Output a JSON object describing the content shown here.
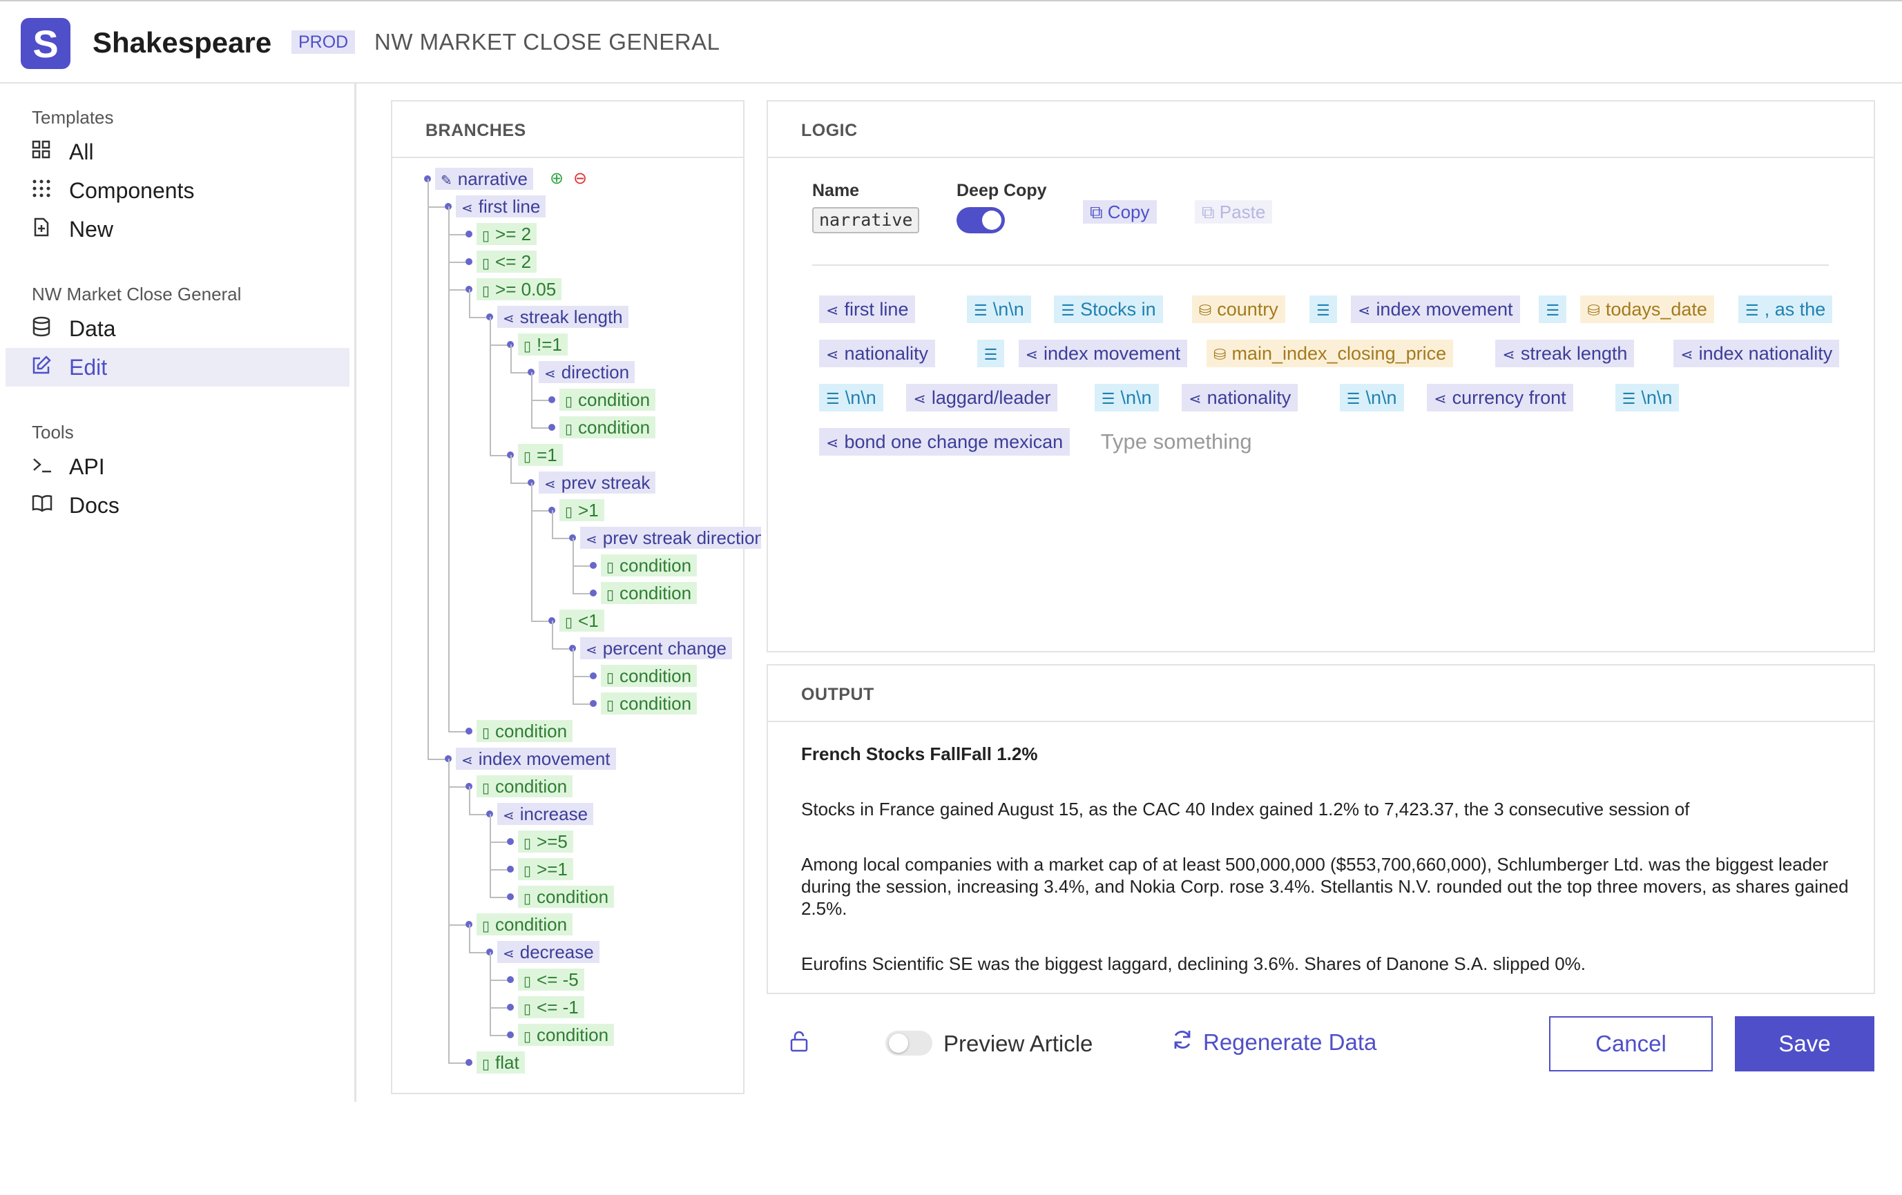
{
  "app": {
    "logo_letter": "S",
    "name": "Shakespeare",
    "env_badge": "PROD",
    "page_title": "NW MARKET CLOSE GENERAL"
  },
  "sidebar": {
    "sections": [
      {
        "title": "Templates",
        "items": [
          {
            "label": "All",
            "icon": "grid-icon"
          },
          {
            "label": "Components",
            "icon": "dots-grid-icon"
          },
          {
            "label": "New",
            "icon": "new-file-icon"
          }
        ]
      },
      {
        "title": "NW Market Close General",
        "items": [
          {
            "label": "Data",
            "icon": "database-icon"
          },
          {
            "label": "Edit",
            "icon": "edit-icon",
            "active": true
          }
        ]
      },
      {
        "title": "Tools",
        "items": [
          {
            "label": "API",
            "icon": "terminal-icon"
          },
          {
            "label": "Docs",
            "icon": "book-icon"
          }
        ]
      }
    ]
  },
  "branches": {
    "title": "BRANCHES",
    "nodes": [
      {
        "label": "narrative",
        "kind": "root",
        "depth": 0
      },
      {
        "label": "first line",
        "kind": "branch",
        "depth": 1
      },
      {
        "label": ">= 2",
        "kind": "condition",
        "depth": 2
      },
      {
        "label": "<= 2",
        "kind": "condition",
        "depth": 2
      },
      {
        "label": ">= 0.05",
        "kind": "condition",
        "depth": 2
      },
      {
        "label": "streak length",
        "kind": "branch",
        "depth": 3
      },
      {
        "label": "!=1",
        "kind": "condition",
        "depth": 4
      },
      {
        "label": "direction",
        "kind": "branch",
        "depth": 5
      },
      {
        "label": "condition",
        "kind": "condition",
        "depth": 6
      },
      {
        "label": "condition",
        "kind": "condition",
        "depth": 6
      },
      {
        "label": "=1",
        "kind": "condition",
        "depth": 4
      },
      {
        "label": "prev streak",
        "kind": "branch",
        "depth": 5
      },
      {
        "label": ">1",
        "kind": "condition",
        "depth": 6
      },
      {
        "label": "prev streak direction",
        "kind": "branch",
        "depth": 7
      },
      {
        "label": "condition",
        "kind": "condition",
        "depth": 8
      },
      {
        "label": "condition",
        "kind": "condition",
        "depth": 8
      },
      {
        "label": "<1",
        "kind": "condition",
        "depth": 6
      },
      {
        "label": "percent change",
        "kind": "branch",
        "depth": 7
      },
      {
        "label": "condition",
        "kind": "condition",
        "depth": 8
      },
      {
        "label": "condition",
        "kind": "condition",
        "depth": 8
      },
      {
        "label": "condition",
        "kind": "condition",
        "depth": 2
      },
      {
        "label": "index movement",
        "kind": "branch",
        "depth": 1
      },
      {
        "label": "condition",
        "kind": "condition",
        "depth": 2
      },
      {
        "label": "increase",
        "kind": "branch",
        "depth": 3
      },
      {
        "label": ">=5",
        "kind": "condition",
        "depth": 4
      },
      {
        "label": ">=1",
        "kind": "condition",
        "depth": 4
      },
      {
        "label": "condition",
        "kind": "condition",
        "depth": 4
      },
      {
        "label": "condition",
        "kind": "condition",
        "depth": 2
      },
      {
        "label": "decrease",
        "kind": "branch",
        "depth": 3
      },
      {
        "label": "<= -5",
        "kind": "condition",
        "depth": 4
      },
      {
        "label": "<= -1",
        "kind": "condition",
        "depth": 4
      },
      {
        "label": "condition",
        "kind": "condition",
        "depth": 4
      },
      {
        "label": "flat",
        "kind": "condition",
        "depth": 2
      }
    ]
  },
  "logic": {
    "title": "LOGIC",
    "name_label": "Name",
    "name_value": "narrative",
    "deep_copy_label": "Deep Copy",
    "deep_copy_on": true,
    "copy_label": "Copy",
    "paste_label": "Paste",
    "input_placeholder": "Type something",
    "tokens": [
      [
        {
          "text": "first line",
          "type": "branch"
        },
        {
          "text": "\\n\\n",
          "type": "text"
        },
        {
          "text": "Stocks in",
          "type": "text"
        },
        {
          "text": "country",
          "type": "data"
        },
        {
          "text": "",
          "type": "text"
        },
        {
          "text": "index movement",
          "type": "branch"
        },
        {
          "text": "",
          "type": "text"
        },
        {
          "text": "todays_date",
          "type": "data"
        },
        {
          "text": ", as the",
          "type": "text"
        }
      ],
      [
        {
          "text": "nationality",
          "type": "branch"
        },
        {
          "text": "",
          "type": "text"
        },
        {
          "text": "index movement",
          "type": "branch"
        },
        {
          "text": "main_index_closing_price",
          "type": "data"
        },
        {
          "text": "streak length",
          "type": "branch"
        },
        {
          "text": "index nationality",
          "type": "branch"
        }
      ],
      [
        {
          "text": "\\n\\n",
          "type": "text"
        },
        {
          "text": "laggard/leader",
          "type": "branch"
        },
        {
          "text": "\\n\\n",
          "type": "text"
        },
        {
          "text": "nationality",
          "type": "branch"
        },
        {
          "text": "\\n\\n",
          "type": "text"
        },
        {
          "text": "currency front",
          "type": "branch"
        },
        {
          "text": "\\n\\n",
          "type": "text"
        }
      ],
      [
        {
          "text": "bond one change mexican",
          "type": "branch"
        }
      ]
    ]
  },
  "output": {
    "title": "OUTPUT",
    "headline": "French Stocks FallFall 1.2%",
    "paragraphs": [
      "Stocks in France gained August 15, as the CAC 40 Index gained 1.2% to 7,423.37, the 3 consecutive session of",
      "Among local companies with a market cap of at least 500,000,000 ($553,700,660,000), Schlumberger Ltd. was the biggest leader during the session, increasing 3.4%, and Nokia Corp. rose 3.4%. Stellantis N.V. rounded out the top three movers, as shares gained 2.5%.",
      "Eurofins Scientific SE was the biggest laggard, declining 3.6%. Shares of Danone S.A. slipped 0%."
    ]
  },
  "footer": {
    "preview_label": "Preview Article",
    "preview_on": false,
    "regenerate_label": "Regenerate Data",
    "cancel_label": "Cancel",
    "save_label": "Save"
  },
  "colors": {
    "accent": "#4f4fc9",
    "branch_bg": "#e4e4f6",
    "condition_bg": "#def5dc",
    "text_token_bg": "#d9f0fa",
    "data_token_bg": "#fbf0d7"
  }
}
